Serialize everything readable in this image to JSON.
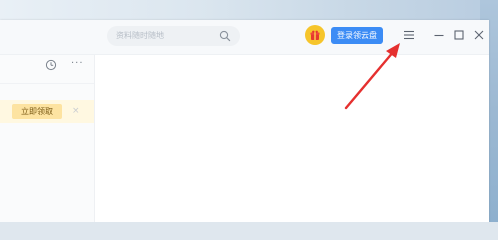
{
  "search": {
    "placeholder": "资料随时随地"
  },
  "header": {
    "login_label": "登录领云盘"
  },
  "sidebar": {
    "promo_button_label": "立即领取",
    "promo_close_label": "×",
    "more_label": "···"
  },
  "icons": {
    "search": "search-icon",
    "avatar": "gift-avatar-icon",
    "menu": "menu-icon",
    "minimize": "minimize-icon",
    "maximize": "maximize-icon",
    "close": "close-icon",
    "history": "clock-icon",
    "more": "more-icon"
  },
  "colors": {
    "accent": "#3c8cf5",
    "annotation_arrow": "#e5302f",
    "promo_background": "#fff8e1",
    "promo_button": "#fde3a1"
  }
}
